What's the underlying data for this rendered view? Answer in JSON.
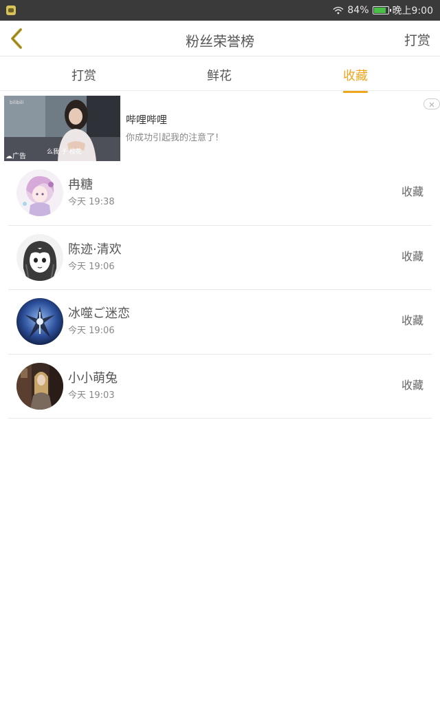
{
  "status_bar": {
    "battery": "84%",
    "time": "晚上9:00"
  },
  "header": {
    "title": "粉丝荣誉榜",
    "right_action": "打赏"
  },
  "tabs": [
    {
      "label": "打赏",
      "active": false
    },
    {
      "label": "鲜花",
      "active": false
    },
    {
      "label": "收藏",
      "active": true
    }
  ],
  "ad": {
    "title": "哔哩哔哩",
    "description": "你成功引起我的注意了!",
    "tag": "广告",
    "thumb_caption": "么我 子 校花",
    "thumb_brand": "bilibili"
  },
  "fans": [
    {
      "name": "冉糖",
      "time": "今天 19:38",
      "action": "收藏"
    },
    {
      "name": "陈迹·清欢",
      "time": "今天 19:06",
      "action": "收藏"
    },
    {
      "name": "冰噬ご迷恋",
      "time": "今天 19:06",
      "action": "收藏"
    },
    {
      "name": "小小萌兔",
      "time": "今天 19:03",
      "action": "收藏"
    }
  ],
  "colors": {
    "accent": "#f0a51e",
    "status_bar_bg": "#3a3a3a",
    "back_arrow": "#b9a02c"
  }
}
